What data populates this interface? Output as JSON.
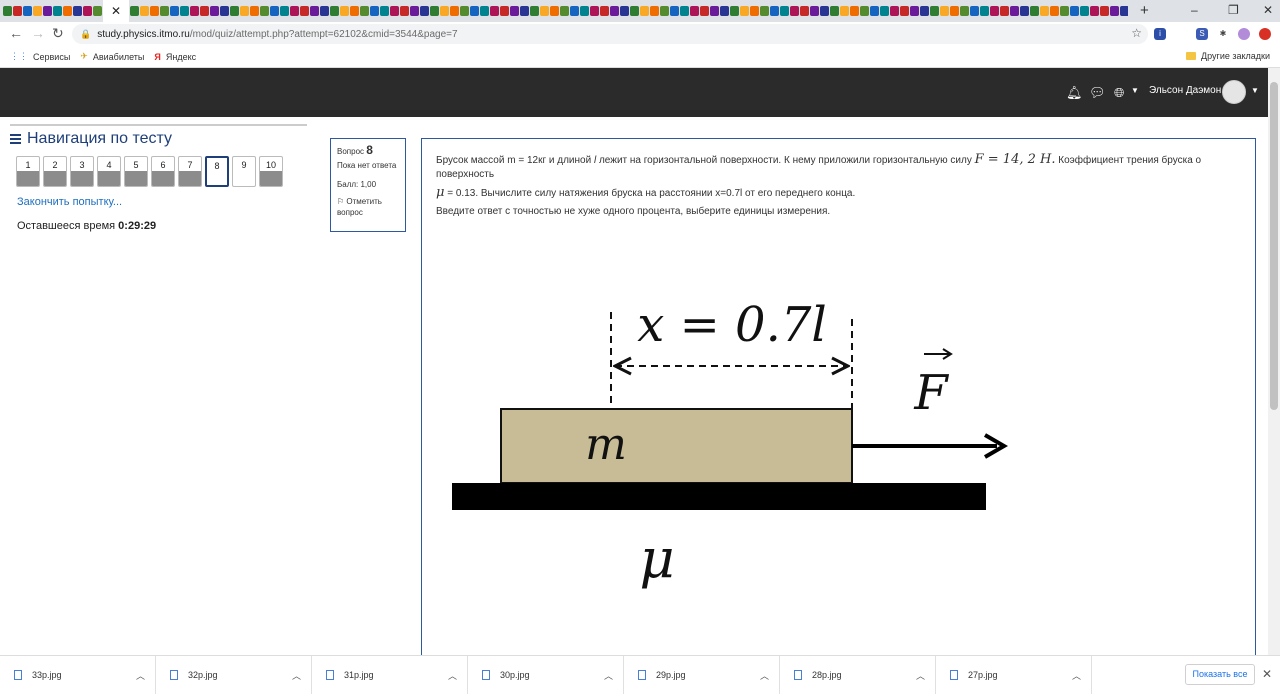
{
  "browser": {
    "url_host": "study.physics.itmo.ru",
    "url_path": "/mod/quiz/attempt.php?attempt=62102&cmid=3544&page=7",
    "bookmarks": [
      "Сервисы",
      "Авиабилеты",
      "Яндекс"
    ],
    "other_bookmarks": "Другие закладки",
    "new_tab": "+",
    "tab_close": "✕"
  },
  "navbar": {
    "user_name": "Эльсон Даэмон"
  },
  "quiz_nav": {
    "title": "Навигация по тесту",
    "buttons": [
      "1",
      "2",
      "3",
      "4",
      "5",
      "6",
      "7",
      "8",
      "9",
      "10"
    ],
    "finish_link": "Закончить попытку...",
    "time_label": "Оставшееся время",
    "time_value": "0:29:29"
  },
  "question_info": {
    "prefix": "Вопрос",
    "number": "8",
    "status": "Пока нет ответа",
    "score": "Балл: 1,00",
    "flag": "Отметить вопрос"
  },
  "question": {
    "t1": "Брусок  массой",
    "m_expr": "m = 12кг",
    "t2": "и длиной",
    "l_sym": "l",
    "t3": "лежит на  горизонтальной поверхности.  К нему приложили горизонтальную    силу",
    "F_expr": "F = 14, 2 Н.",
    "t4": "Коэффициент трения бруска о поверхность",
    "mu_sym": "μ",
    "t5": "= 0.13.   Вычислите силу натяжения бруска на расстоянии",
    "x_expr": "x=0.7l",
    "t6": "от его переднего конца.",
    "instruction": "Введите ответ с точностью не хуже одного процента, выберите единицы измерения."
  },
  "figure": {
    "x_label": "x = 0.7l",
    "F_label": "F",
    "m_label": "m",
    "mu_label": "μ",
    "block_color": "#c8bc96"
  },
  "downloads": {
    "files": [
      "33p.jpg",
      "32p.jpg",
      "31p.jpg",
      "30p.jpg",
      "29p.jpg",
      "28p.jpg",
      "27p.jpg"
    ],
    "show_all": "Показать все"
  }
}
